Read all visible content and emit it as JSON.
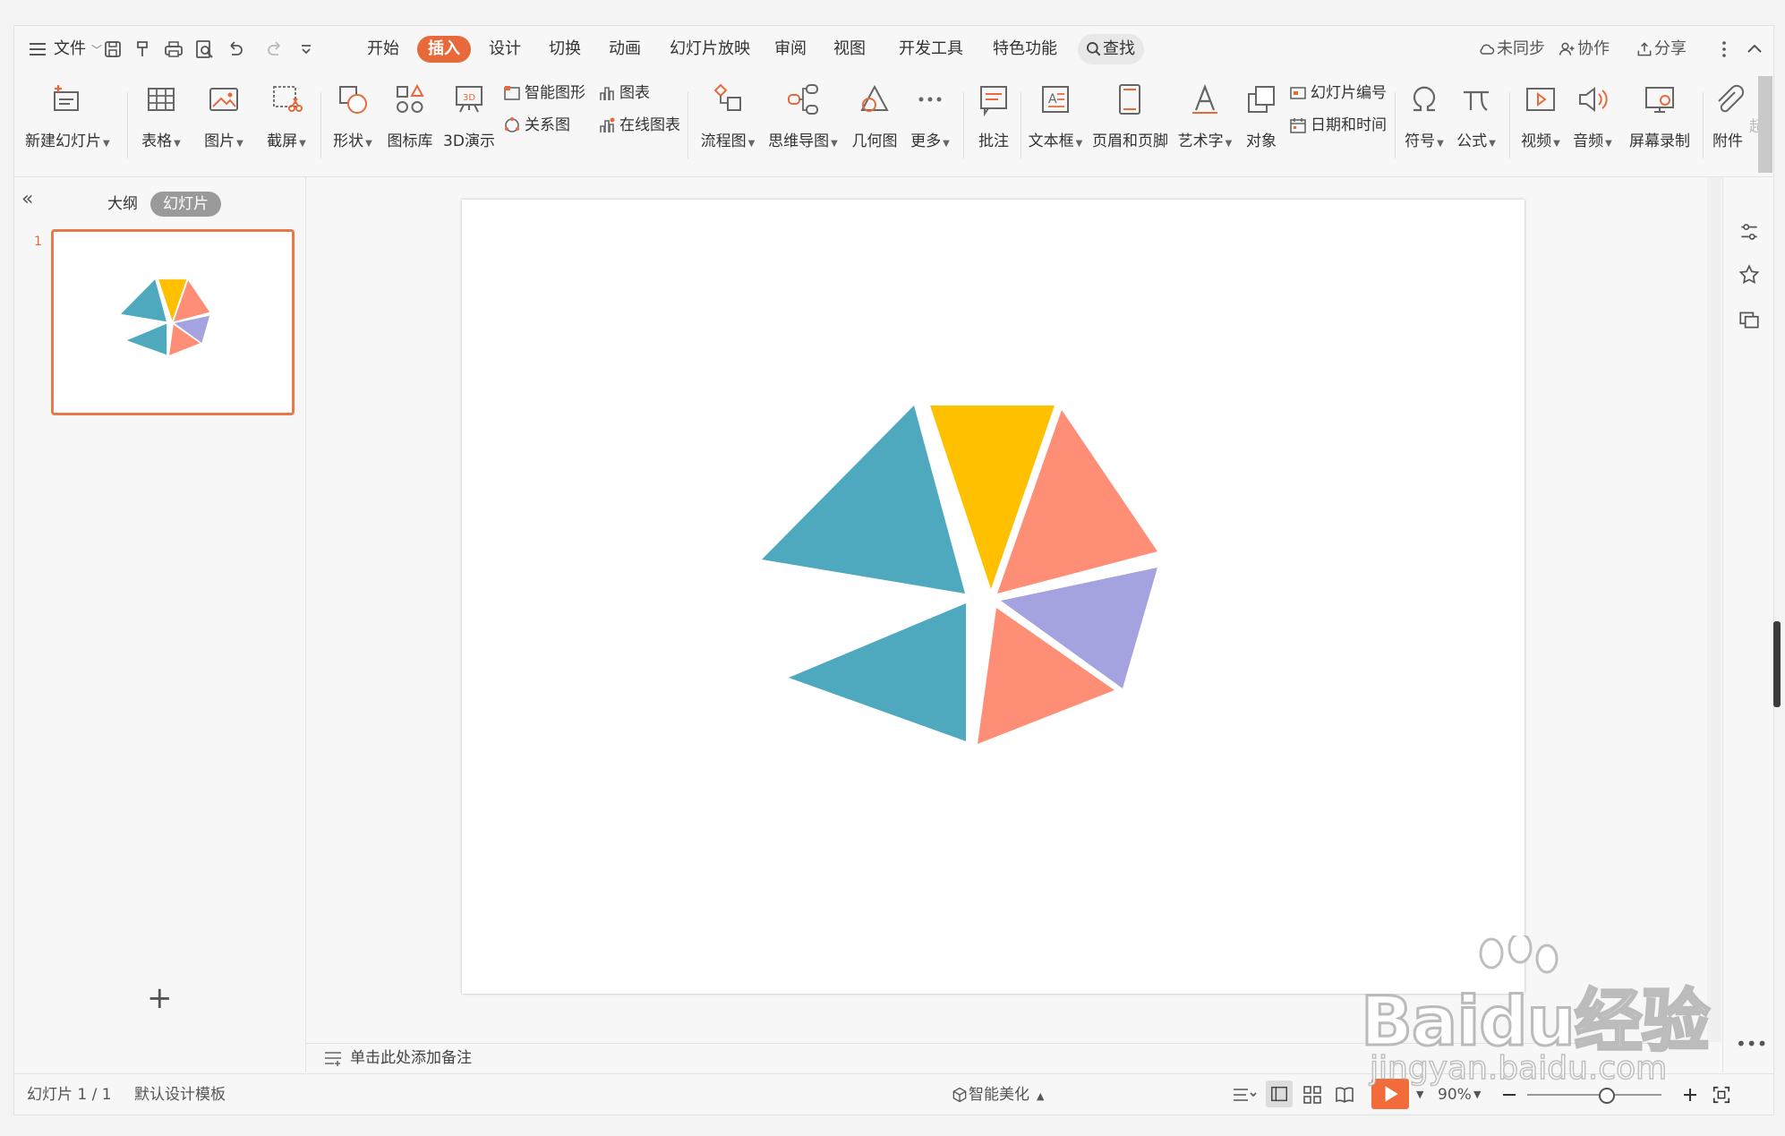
{
  "menu": {
    "file_label": "文件",
    "tabs": [
      "开始",
      "插入",
      "设计",
      "切换",
      "动画",
      "幻灯片放映",
      "审阅",
      "视图",
      "开发工具",
      "特色功能"
    ],
    "search_label": "查找",
    "right": {
      "sync": "未同步",
      "collab": "协作",
      "share": "分享"
    }
  },
  "ribbon": {
    "new_slide": "新建幻灯片",
    "table": "表格",
    "picture": "图片",
    "screenshot": "截屏",
    "shapes": "形状",
    "icon_lib": "图标库",
    "demo3d": "3D演示",
    "smart_art": "智能图形",
    "chart": "图表",
    "relation": "关系图",
    "online_chart": "在线图表",
    "flowchart": "流程图",
    "mindmap": "思维导图",
    "geometry": "几何图",
    "more": "更多",
    "comment": "批注",
    "textbox": "文本框",
    "header_footer": "页眉和页脚",
    "wordart": "艺术字",
    "object": "对象",
    "slide_number": "幻灯片编号",
    "datetime": "日期和时间",
    "symbol": "符号",
    "formula": "公式",
    "video": "视频",
    "audio": "音频",
    "screen_record": "屏幕录制",
    "attachment": "附件",
    "hyperlink_cut": "超"
  },
  "panel": {
    "outline_tab": "大纲",
    "slides_tab": "幻灯片",
    "slide_index": "1",
    "add_symbol": "+"
  },
  "notes": {
    "placeholder": "单击此处添加备注"
  },
  "status": {
    "slide_info": "幻灯片 1 / 1",
    "template": "默认设计模板",
    "beautify": "智能美化",
    "zoom": "90%"
  },
  "watermark": {
    "brand": "Baidu经验",
    "url": "jingyan.baidu.com"
  },
  "colors": {
    "accent": "#e86a3a",
    "teal": "#4ea9bf",
    "yellow": "#ffc000",
    "salmon": "#fe8e75",
    "lavender": "#a4a3e0"
  }
}
